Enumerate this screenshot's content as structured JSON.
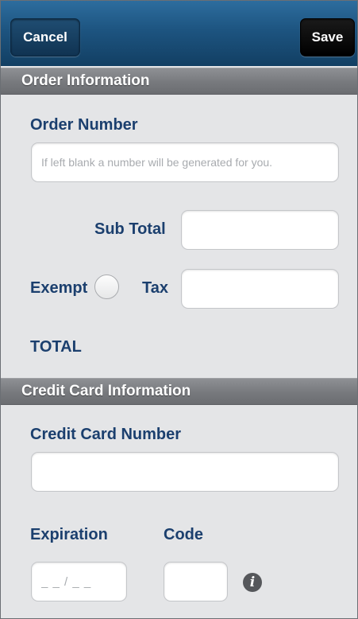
{
  "navbar": {
    "cancel_label": "Cancel",
    "save_label": "Save"
  },
  "order_section": {
    "header": "Order Information",
    "order_number_label": "Order Number",
    "order_number_placeholder": "If left blank a number will be generated for you.",
    "subtotal_label": "Sub Total",
    "exempt_label": "Exempt",
    "tax_label": "Tax",
    "total_label": "TOTAL"
  },
  "card_section": {
    "header": "Credit Card Information",
    "card_number_label": "Credit Card Number",
    "expiration_label": "Expiration",
    "expiration_placeholder": "_ _ / _ _",
    "code_label": "Code",
    "info_icon": "info-icon"
  }
}
